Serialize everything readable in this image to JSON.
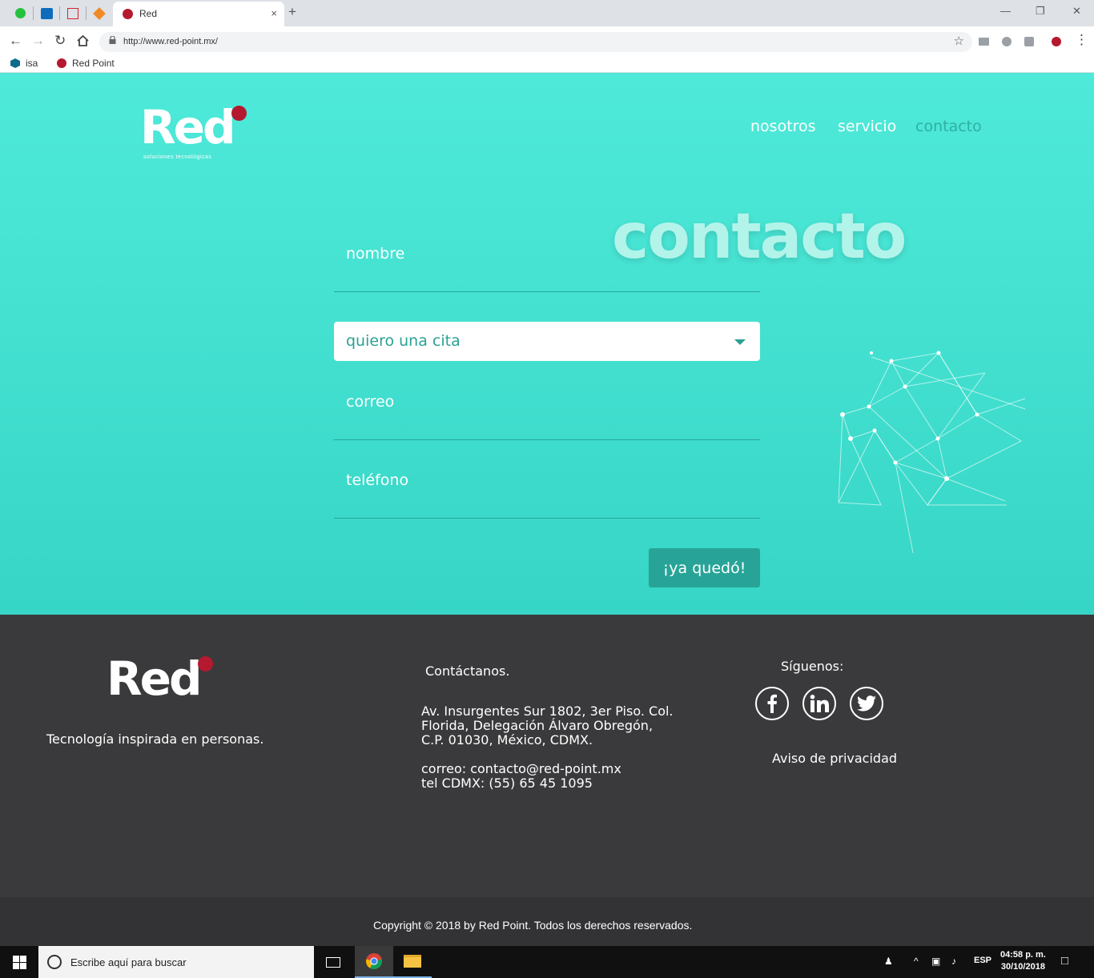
{
  "browser": {
    "tab_title": "Red",
    "tab_close": "×",
    "new_tab": "+",
    "url": "http://www.red-point.mx/",
    "bookmarks": [
      {
        "label": "isa",
        "icon": "hexagon-icon"
      },
      {
        "label": "Red Point",
        "icon": "red-dot-icon"
      }
    ],
    "colors": {
      "tabstrip": "#dee1e6",
      "favicon": "#b5192f"
    }
  },
  "site": {
    "logo": {
      "word": "Red",
      "subtitle": "soluciones tecnológicas"
    },
    "nav": [
      {
        "label": "nosotros",
        "active": false
      },
      {
        "label": "servicio",
        "active": false
      },
      {
        "label": "contacto",
        "active": true
      }
    ],
    "page_title": "contacto",
    "form": {
      "nombre_placeholder": "nombre",
      "select_value": "quiero una cita",
      "correo_placeholder": "correo",
      "telefono_placeholder": "teléfono",
      "submit_label": "¡ya quedó!"
    },
    "colors": {
      "hero_top": "#4ee9d9",
      "hero_bottom": "#36d5c5",
      "accent": "#27a497",
      "brand_red": "#b5192f"
    }
  },
  "footer": {
    "logo_word": "Red",
    "tagline": "Tecnología inspirada en personas.",
    "contact_heading": "Contáctanos.",
    "address_lines": [
      "Av. Insurgentes Sur 1802, 3er Piso. Col.",
      "Florida, Delegación Álvaro Obregón,",
      "C.P. 01030, México, CDMX."
    ],
    "email_line": "correo: contacto@red-point.mx",
    "phone_line": "tel CDMX: (55) 65 45 1095",
    "follow_heading": "Síguenos:",
    "social": [
      "facebook-icon",
      "linkedin-icon",
      "twitter-icon"
    ],
    "privacy_link": "Aviso de privacidad",
    "copyright": "Copyright © 2018 by Red Point. Todos los derechos reservados."
  },
  "taskbar": {
    "search_placeholder": "Escribe aquí para buscar",
    "language": "ESP",
    "time": "04:58 p. m.",
    "date": "30/10/2018"
  }
}
